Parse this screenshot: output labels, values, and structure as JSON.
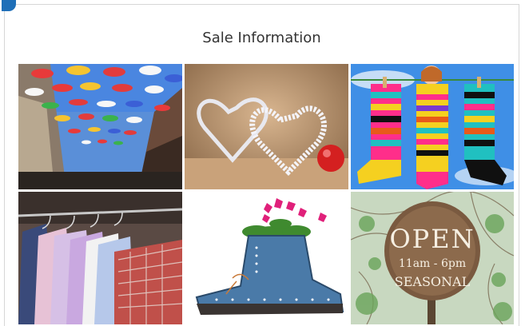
{
  "page": {
    "title": "Sale Information"
  },
  "gallery": {
    "tiles": [
      {
        "subject": "umbrellas-street-photo"
      },
      {
        "subject": "crystal-hearts-photo"
      },
      {
        "subject": "striped-socks-photo"
      },
      {
        "subject": "shirts-rack-photo"
      },
      {
        "subject": "boot-flowerpot-photo"
      },
      {
        "subject": "open-sign-photo"
      }
    ]
  },
  "sign": {
    "line1": "OPEN",
    "line2": "11am - 6pm",
    "line3": "SEASONAL"
  },
  "colors": {
    "accent": "#1f6fb8",
    "title_text": "#333333",
    "border": "#d6d6d6"
  }
}
